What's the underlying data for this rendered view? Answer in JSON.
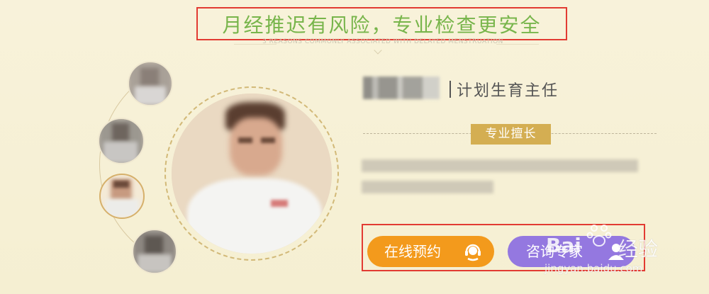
{
  "header": {
    "title": "月经推迟有风险，专业检查更安全",
    "subtitle": "3 REASONS COMMONLY ASSOCIATED WITH DELAYED MENSTRUATION"
  },
  "doctor": {
    "title": "计划生育主任",
    "specialty_label": "专业擅长"
  },
  "actions": {
    "book_label": "在线预约",
    "consult_label": "咨询专家"
  },
  "watermark": {
    "brand": "Bai",
    "brand_suffix": "经验",
    "url": "jingyan.baidu.com"
  },
  "colors": {
    "title_green": "#78b54b",
    "annotation_red": "#e23b32",
    "badge_gold": "#d4ae52",
    "book_orange": "#f39a1c",
    "consult_purple": "#9478e0",
    "background": "#f7f1d8"
  }
}
